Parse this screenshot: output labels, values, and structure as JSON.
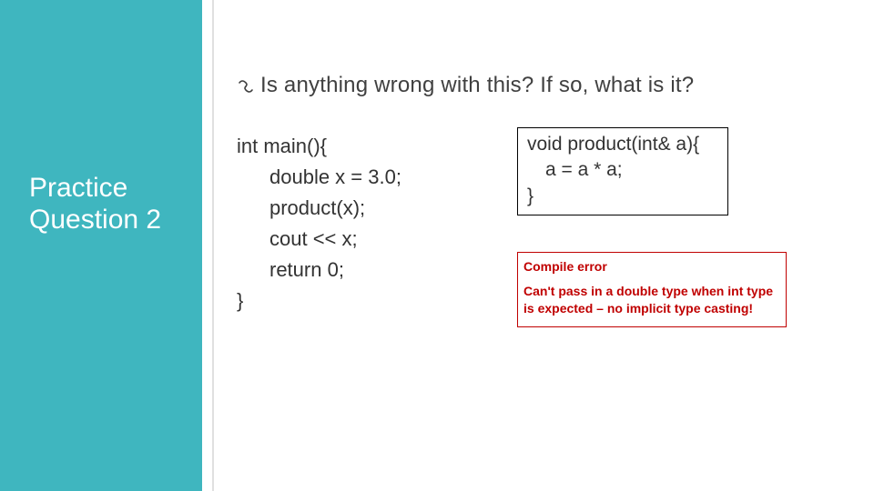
{
  "sidebar": {
    "title_line1": "Practice",
    "title_line2": "Question 2"
  },
  "question": "Is anything wrong with this? If so, what is it?",
  "main_code": {
    "l1": "int main(){",
    "l2": "double x = 3.0;",
    "l3": "product(x);",
    "l4": "cout << x;",
    "l5": "return 0;",
    "l6": "}"
  },
  "func_code": {
    "l1": "void product(int& a){",
    "l2": "a = a * a;",
    "l3": "}"
  },
  "answer": {
    "l1": "Compile error",
    "l2": "Can't pass in a double type when int type is expected – no implicit type casting!"
  },
  "icons": {
    "bullet": "link-bullet-icon"
  }
}
